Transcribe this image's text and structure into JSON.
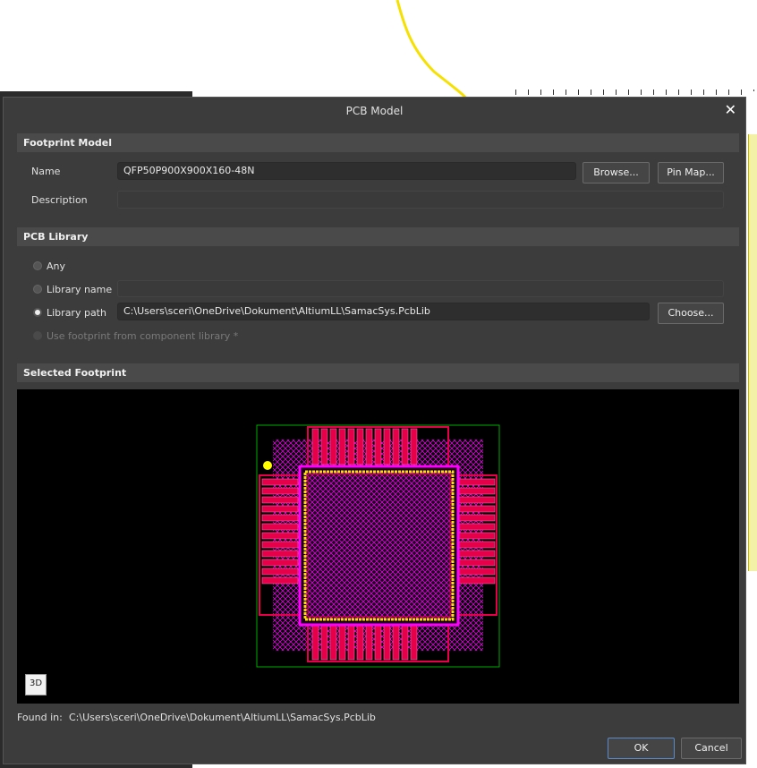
{
  "dialog": {
    "title": "PCB Model",
    "close_glyph": "✕"
  },
  "footprint_model": {
    "header": "Footprint Model",
    "name_label": "Name",
    "name_value": "QFP50P900X900X160-48N",
    "description_label": "Description",
    "description_value": "",
    "browse_button": "Browse...",
    "pin_map_button": "Pin Map..."
  },
  "pcb_library": {
    "header": "PCB Library",
    "options": {
      "any": {
        "label": "Any",
        "selected": false
      },
      "library_name": {
        "label": "Library name",
        "selected": false,
        "value": ""
      },
      "library_path": {
        "label": "Library path",
        "selected": true,
        "value": "C:\\Users\\sceri\\OneDrive\\Dokument\\AltiumLL\\SamacSys.PcbLib"
      },
      "use_component_lib": {
        "label": "Use footprint from component library *",
        "selected": false,
        "enabled": false
      }
    },
    "choose_button": "Choose..."
  },
  "selected_footprint": {
    "header": "Selected Footprint",
    "view_3d_button": "3D",
    "found_in_label": "Found in:",
    "found_in_value": "C:\\Users\\sceri\\OneDrive\\Dokument\\AltiumLL\\SamacSys.PcbLib",
    "colors": {
      "pad": "#e6004a",
      "pad_outline": "#ff66aa",
      "silkscreen": "#ff00ff",
      "courtyard": "#00aa00",
      "body_outline": "#ffdd00",
      "pin1_marker": "#ffff00",
      "background": "#000000"
    },
    "pins_per_side": 12
  },
  "footer": {
    "ok_button": "OK",
    "cancel_button": "Cancel"
  }
}
